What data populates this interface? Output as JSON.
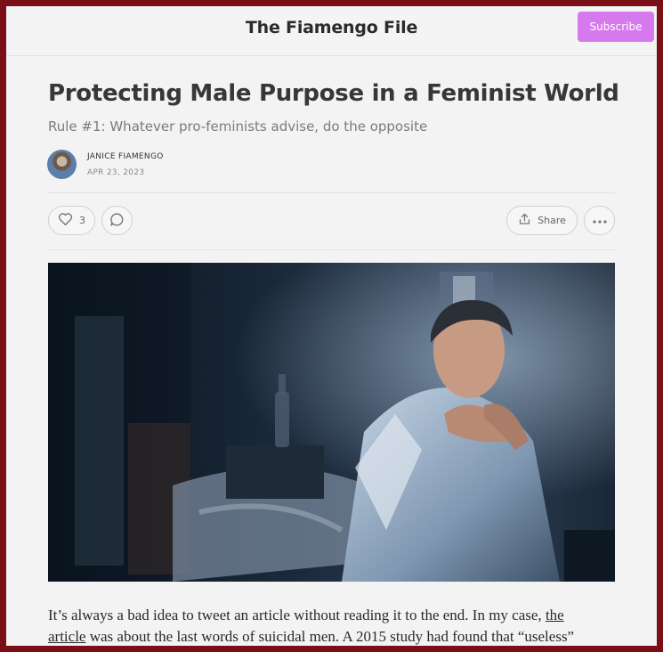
{
  "header": {
    "publication_title": "The Fiamengo File",
    "subscribe_label": "Subscribe"
  },
  "post": {
    "title": "Protecting Male Purpose in a Feminist World",
    "subtitle": "Rule #1: Whatever pro-feminists advise, do the opposite",
    "author": "JANICE FIAMENGO",
    "date": "APR 23, 2023"
  },
  "actions": {
    "like_count": "3",
    "share_label": "Share"
  },
  "body": {
    "line1_before_link": "It’s always a bad idea to tweet an article without reading it to the end. In my case, ",
    "line1_link": "the",
    "line2_link": "article",
    "line2_after_link": " was about the last words of suicidal men. A 2015 study had found that “useless”"
  },
  "colors": {
    "frame_border": "#7a0f16",
    "subscribe_bg": "#d779ee",
    "page_bg": "#f3f3f3"
  },
  "icons": [
    "heart-icon",
    "comment-icon",
    "share-icon",
    "more-icon"
  ]
}
